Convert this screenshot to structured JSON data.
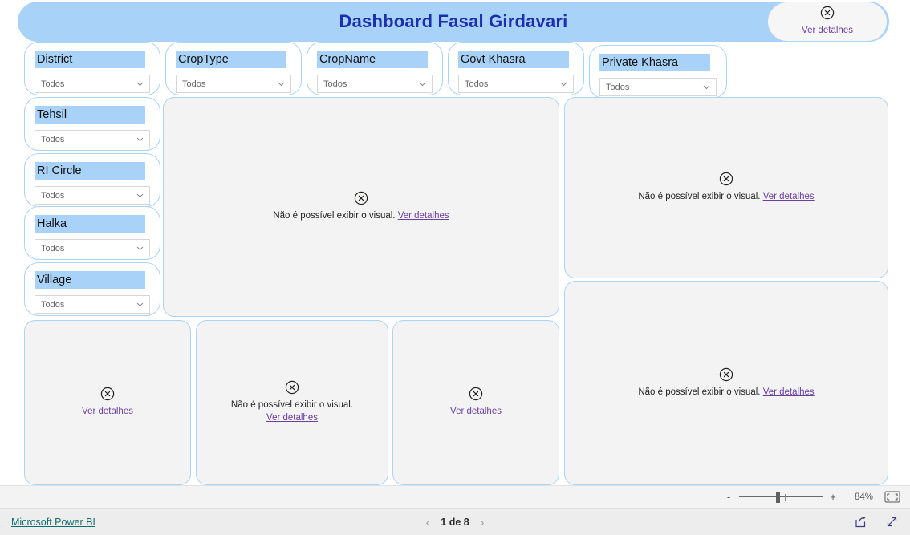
{
  "header": {
    "title": "Dashboard Fasal Girdavari",
    "banner_color": "#A8D2F7",
    "title_color": "#1C2FB0"
  },
  "error": {
    "message": "Não é possível exibir o visual.",
    "link": "Ver detalhes",
    "icon": "error-circle-x-icon"
  },
  "slicers": {
    "placeholder_value": "Todos",
    "top_row": [
      {
        "label": "District"
      },
      {
        "label": "CropType"
      },
      {
        "label": "CropName"
      },
      {
        "label": "Govt Khasra"
      },
      {
        "label": "Private Khasra"
      }
    ],
    "side_column": [
      {
        "label": "Tehsil"
      },
      {
        "label": "RI Circle"
      },
      {
        "label": "Halka"
      },
      {
        "label": "Village"
      }
    ]
  },
  "visuals": [
    {
      "name": "visual-center-large",
      "mode": "full"
    },
    {
      "name": "visual-right-top",
      "mode": "full"
    },
    {
      "name": "visual-right-bottom",
      "mode": "full"
    },
    {
      "name": "visual-bottom-1",
      "mode": "link-only"
    },
    {
      "name": "visual-bottom-2",
      "mode": "wrapped"
    },
    {
      "name": "visual-bottom-3",
      "mode": "link-only"
    },
    {
      "name": "visual-header-corner",
      "mode": "link-only"
    }
  ],
  "statusbar": {
    "zoom_out_label": "-",
    "zoom_in_label": "+",
    "zoom_level": "84%",
    "fit_icon": "fit-to-page-icon"
  },
  "footer": {
    "brand": "Microsoft Power BI",
    "prev_icon": "chevron-left-icon",
    "next_icon": "chevron-right-icon",
    "page_label": "1 de 8",
    "share_icon": "share-export-icon",
    "fullscreen_icon": "fullscreen-expand-icon"
  }
}
